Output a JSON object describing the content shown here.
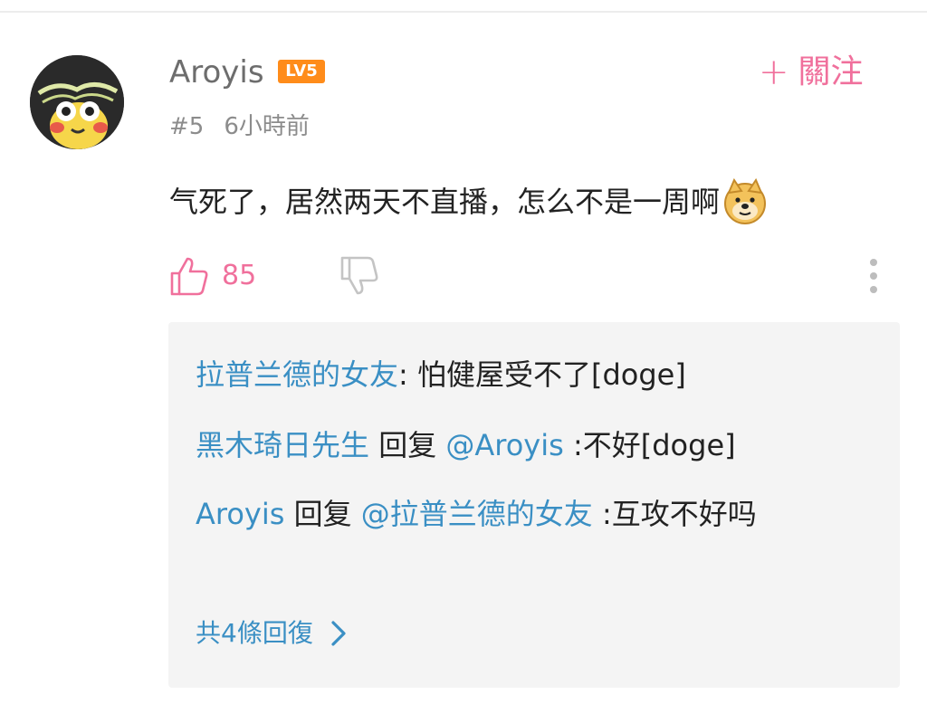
{
  "comment": {
    "username": "Aroyis",
    "level_badge": "LV5",
    "follow_label": "關注",
    "floor": "#5",
    "time": "6小時前",
    "text": "气死了，居然两天不直播，怎么不是一周啊",
    "emoji_icon": "doge-emoji-icon",
    "like_count": "85",
    "icons": {
      "like": "thumbs-up-icon",
      "dislike": "thumbs-down-icon",
      "more": "more-vertical-icon",
      "follow": "plus-icon",
      "expand": "chevron-right-icon"
    }
  },
  "replies": [
    {
      "author": "拉普兰德的女友",
      "reply_word": "",
      "mention": "",
      "text": ": 怕健屋受不了[doge]"
    },
    {
      "author": "黑木琦日先生",
      "reply_word": "回复",
      "mention": "@Aroyis",
      "text": ":不好[doge]"
    },
    {
      "author": "Aroyis",
      "reply_word": "回复",
      "mention": "@拉普兰德的女友",
      "text": ":互攻不好吗"
    }
  ],
  "more_replies_label": "共4條回復",
  "colors": {
    "accent_pink": "#f0709c",
    "link_blue": "#3a8fc4",
    "badge_orange": "#ff8c1a",
    "reply_bg": "#f4f4f4"
  }
}
